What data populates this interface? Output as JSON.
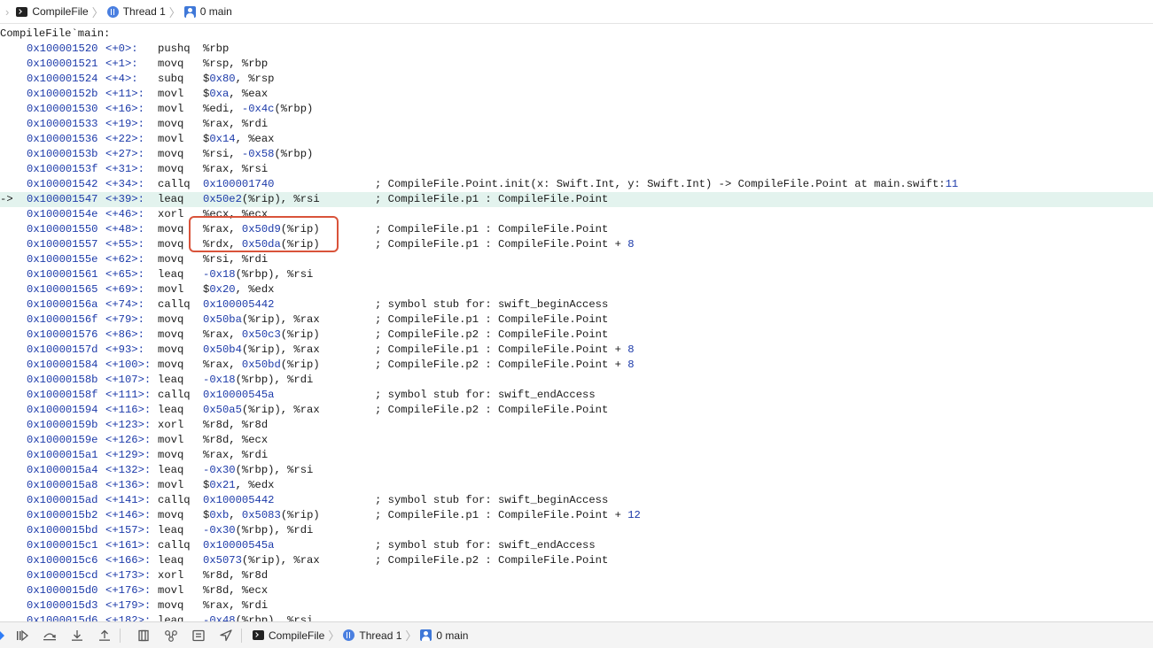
{
  "breadcrumb": {
    "items": [
      {
        "label": "CompileFile",
        "icon": "terminal-icon"
      },
      {
        "label": "Thread 1",
        "icon": "thread-icon"
      },
      {
        "label": "0 main",
        "icon": "stack-frame-icon"
      }
    ]
  },
  "disassembly": {
    "header": "CompileFile`main:",
    "current_arrow": "->",
    "rows": [
      {
        "addr": "0x100001520",
        "off": "<+0>:",
        "mn": "pushq",
        "ops": [
          [
            "%rbp",
            0
          ]
        ],
        "cmt": []
      },
      {
        "addr": "0x100001521",
        "off": "<+1>:",
        "mn": "movq",
        "ops": [
          [
            "%rsp, %rbp",
            0
          ]
        ],
        "cmt": []
      },
      {
        "addr": "0x100001524",
        "off": "<+4>:",
        "mn": "subq",
        "ops": [
          [
            "$",
            0
          ],
          [
            "0x80",
            1
          ],
          [
            ", %rsp",
            0
          ]
        ],
        "cmt": []
      },
      {
        "addr": "0x10000152b",
        "off": "<+11>:",
        "mn": "movl",
        "ops": [
          [
            "$",
            0
          ],
          [
            "0xa",
            1
          ],
          [
            ", %eax",
            0
          ]
        ],
        "cmt": []
      },
      {
        "addr": "0x100001530",
        "off": "<+16>:",
        "mn": "movl",
        "ops": [
          [
            "%edi, ",
            0
          ],
          [
            "-0x4c",
            1
          ],
          [
            "(%rbp)",
            0
          ]
        ],
        "cmt": []
      },
      {
        "addr": "0x100001533",
        "off": "<+19>:",
        "mn": "movq",
        "ops": [
          [
            "%rax, %rdi",
            0
          ]
        ],
        "cmt": []
      },
      {
        "addr": "0x100001536",
        "off": "<+22>:",
        "mn": "movl",
        "ops": [
          [
            "$",
            0
          ],
          [
            "0x14",
            1
          ],
          [
            ", %eax",
            0
          ]
        ],
        "cmt": []
      },
      {
        "addr": "0x10000153b",
        "off": "<+27>:",
        "mn": "movq",
        "ops": [
          [
            "%rsi, ",
            0
          ],
          [
            "-0x58",
            1
          ],
          [
            "(%rbp)",
            0
          ]
        ],
        "cmt": []
      },
      {
        "addr": "0x10000153f",
        "off": "<+31>:",
        "mn": "movq",
        "ops": [
          [
            "%rax, %rsi",
            0
          ]
        ],
        "cmt": []
      },
      {
        "addr": "0x100001542",
        "off": "<+34>:",
        "mn": "callq",
        "ops": [
          [
            "0x100001740",
            1
          ]
        ],
        "cmt": [
          [
            "; CompileFile.Point.init(x: Swift.Int, y: Swift.Int) -> CompileFile.Point at main.swift:",
            0
          ],
          [
            "11",
            1
          ]
        ]
      },
      {
        "addr": "0x100001547",
        "off": "<+39>:",
        "mn": "leaq",
        "ops": [
          [
            "0x50e2",
            1
          ],
          [
            "(%rip), %rsi",
            0
          ]
        ],
        "cmt": [
          [
            "; CompileFile.p1 : CompileFile.Point",
            0
          ]
        ],
        "current": true
      },
      {
        "addr": "0x10000154e",
        "off": "<+46>:",
        "mn": "xorl",
        "ops": [
          [
            "%ecx, %ecx",
            0
          ]
        ],
        "cmt": []
      },
      {
        "addr": "0x100001550",
        "off": "<+48>:",
        "mn": "movq",
        "ops": [
          [
            "%rax, ",
            0
          ],
          [
            "0x50d9",
            1
          ],
          [
            "(%rip)",
            0
          ]
        ],
        "cmt": [
          [
            "; CompileFile.p1 : CompileFile.Point",
            0
          ]
        ]
      },
      {
        "addr": "0x100001557",
        "off": "<+55>:",
        "mn": "movq",
        "ops": [
          [
            "%rdx, ",
            0
          ],
          [
            "0x50da",
            1
          ],
          [
            "(%rip)",
            0
          ]
        ],
        "cmt": [
          [
            "; CompileFile.p1 : CompileFile.Point + ",
            0
          ],
          [
            "8",
            1
          ]
        ]
      },
      {
        "addr": "0x10000155e",
        "off": "<+62>:",
        "mn": "movq",
        "ops": [
          [
            "%rsi, %rdi",
            0
          ]
        ],
        "cmt": []
      },
      {
        "addr": "0x100001561",
        "off": "<+65>:",
        "mn": "leaq",
        "ops": [
          [
            "-0x18",
            1
          ],
          [
            "(%rbp), %rsi",
            0
          ]
        ],
        "cmt": []
      },
      {
        "addr": "0x100001565",
        "off": "<+69>:",
        "mn": "movl",
        "ops": [
          [
            "$",
            0
          ],
          [
            "0x20",
            1
          ],
          [
            ", %edx",
            0
          ]
        ],
        "cmt": []
      },
      {
        "addr": "0x10000156a",
        "off": "<+74>:",
        "mn": "callq",
        "ops": [
          [
            "0x100005442",
            1
          ]
        ],
        "cmt": [
          [
            "; symbol stub for: swift_beginAccess",
            0
          ]
        ]
      },
      {
        "addr": "0x10000156f",
        "off": "<+79>:",
        "mn": "movq",
        "ops": [
          [
            "0x50ba",
            1
          ],
          [
            "(%rip), %rax",
            0
          ]
        ],
        "cmt": [
          [
            "; CompileFile.p1 : CompileFile.Point",
            0
          ]
        ]
      },
      {
        "addr": "0x100001576",
        "off": "<+86>:",
        "mn": "movq",
        "ops": [
          [
            "%rax, ",
            0
          ],
          [
            "0x50c3",
            1
          ],
          [
            "(%rip)",
            0
          ]
        ],
        "cmt": [
          [
            "; CompileFile.p2 : CompileFile.Point",
            0
          ]
        ]
      },
      {
        "addr": "0x10000157d",
        "off": "<+93>:",
        "mn": "movq",
        "ops": [
          [
            "0x50b4",
            1
          ],
          [
            "(%rip), %rax",
            0
          ]
        ],
        "cmt": [
          [
            "; CompileFile.p1 : CompileFile.Point + ",
            0
          ],
          [
            "8",
            1
          ]
        ]
      },
      {
        "addr": "0x100001584",
        "off": "<+100>:",
        "mn": "movq",
        "ops": [
          [
            "%rax, ",
            0
          ],
          [
            "0x50bd",
            1
          ],
          [
            "(%rip)",
            0
          ]
        ],
        "cmt": [
          [
            "; CompileFile.p2 : CompileFile.Point + ",
            0
          ],
          [
            "8",
            1
          ]
        ]
      },
      {
        "addr": "0x10000158b",
        "off": "<+107>:",
        "mn": "leaq",
        "ops": [
          [
            "-0x18",
            1
          ],
          [
            "(%rbp), %rdi",
            0
          ]
        ],
        "cmt": []
      },
      {
        "addr": "0x10000158f",
        "off": "<+111>:",
        "mn": "callq",
        "ops": [
          [
            "0x10000545a",
            1
          ]
        ],
        "cmt": [
          [
            "; symbol stub for: swift_endAccess",
            0
          ]
        ]
      },
      {
        "addr": "0x100001594",
        "off": "<+116>:",
        "mn": "leaq",
        "ops": [
          [
            "0x50a5",
            1
          ],
          [
            "(%rip), %rax",
            0
          ]
        ],
        "cmt": [
          [
            "; CompileFile.p2 : CompileFile.Point",
            0
          ]
        ]
      },
      {
        "addr": "0x10000159b",
        "off": "<+123>:",
        "mn": "xorl",
        "ops": [
          [
            "%r8d, %r8d",
            0
          ]
        ],
        "cmt": []
      },
      {
        "addr": "0x10000159e",
        "off": "<+126>:",
        "mn": "movl",
        "ops": [
          [
            "%r8d, %ecx",
            0
          ]
        ],
        "cmt": []
      },
      {
        "addr": "0x1000015a1",
        "off": "<+129>:",
        "mn": "movq",
        "ops": [
          [
            "%rax, %rdi",
            0
          ]
        ],
        "cmt": []
      },
      {
        "addr": "0x1000015a4",
        "off": "<+132>:",
        "mn": "leaq",
        "ops": [
          [
            "-0x30",
            1
          ],
          [
            "(%rbp), %rsi",
            0
          ]
        ],
        "cmt": []
      },
      {
        "addr": "0x1000015a8",
        "off": "<+136>:",
        "mn": "movl",
        "ops": [
          [
            "$",
            0
          ],
          [
            "0x21",
            1
          ],
          [
            ", %edx",
            0
          ]
        ],
        "cmt": []
      },
      {
        "addr": "0x1000015ad",
        "off": "<+141>:",
        "mn": "callq",
        "ops": [
          [
            "0x100005442",
            1
          ]
        ],
        "cmt": [
          [
            "; symbol stub for: swift_beginAccess",
            0
          ]
        ]
      },
      {
        "addr": "0x1000015b2",
        "off": "<+146>:",
        "mn": "movq",
        "ops": [
          [
            "$",
            0
          ],
          [
            "0xb",
            1
          ],
          [
            ", ",
            0
          ],
          [
            "0x5083",
            1
          ],
          [
            "(%rip)",
            0
          ]
        ],
        "cmt": [
          [
            "; CompileFile.p1 : CompileFile.Point + ",
            0
          ],
          [
            "12",
            1
          ]
        ]
      },
      {
        "addr": "0x1000015bd",
        "off": "<+157>:",
        "mn": "leaq",
        "ops": [
          [
            "-0x30",
            1
          ],
          [
            "(%rbp), %rdi",
            0
          ]
        ],
        "cmt": []
      },
      {
        "addr": "0x1000015c1",
        "off": "<+161>:",
        "mn": "callq",
        "ops": [
          [
            "0x10000545a",
            1
          ]
        ],
        "cmt": [
          [
            "; symbol stub for: swift_endAccess",
            0
          ]
        ]
      },
      {
        "addr": "0x1000015c6",
        "off": "<+166>:",
        "mn": "leaq",
        "ops": [
          [
            "0x5073",
            1
          ],
          [
            "(%rip), %rax",
            0
          ]
        ],
        "cmt": [
          [
            "; CompileFile.p2 : CompileFile.Point",
            0
          ]
        ]
      },
      {
        "addr": "0x1000015cd",
        "off": "<+173>:",
        "mn": "xorl",
        "ops": [
          [
            "%r8d, %r8d",
            0
          ]
        ],
        "cmt": []
      },
      {
        "addr": "0x1000015d0",
        "off": "<+176>:",
        "mn": "movl",
        "ops": [
          [
            "%r8d, %ecx",
            0
          ]
        ],
        "cmt": []
      },
      {
        "addr": "0x1000015d3",
        "off": "<+179>:",
        "mn": "movq",
        "ops": [
          [
            "%rax, %rdi",
            0
          ]
        ],
        "cmt": []
      },
      {
        "addr": "0x1000015d6",
        "off": "<+182>:",
        "mn": "leaq",
        "ops": [
          [
            "-0x48",
            1
          ],
          [
            "(%rbp), %rsi",
            0
          ]
        ],
        "cmt": []
      }
    ]
  },
  "debug_toolbar": {
    "buttons": [
      "continue-icon",
      "step-over-icon",
      "step-into-icon",
      "step-out-icon",
      "view-debugger-icon",
      "memory-graph-icon",
      "environment-icon",
      "location-icon"
    ],
    "breadcrumb": [
      {
        "label": "CompileFile"
      },
      {
        "label": "Thread 1"
      },
      {
        "label": "0 main"
      }
    ]
  },
  "colors": {
    "number": "#1c3aa9",
    "current_line": "#e3f3ee",
    "highlight_box": "#d9533a"
  }
}
